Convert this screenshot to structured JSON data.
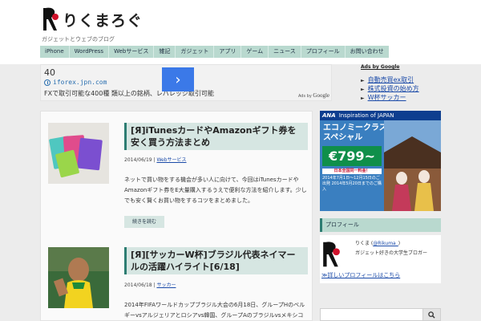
{
  "site": {
    "logo_text": "りくまろぐ",
    "tagline": "ガジェットとウェブのブログ"
  },
  "nav": {
    "items": [
      "iPhone",
      "WordPress",
      "Webサービス",
      "雑記",
      "ガジェット",
      "アプリ",
      "ゲーム",
      "ニュース",
      "プロフィール",
      "お問い合わせ"
    ]
  },
  "ad_top": {
    "price": "40",
    "url": "iforex.jpn.com",
    "description": "FXで取引可能な400種 類以上の銘柄、レバレッジ取引可能",
    "arrow": "›",
    "ads_by": "Ads by",
    "google": "Google"
  },
  "side_ads": {
    "heading": "Ads by Google",
    "links": [
      "自動売買ex取引",
      "株式投資の始め方",
      "W杯サッカー"
    ]
  },
  "posts": [
    {
      "title": "[Я]iTunesカードやAmazonギフト券を安く買う方法まとめ",
      "date": "2014/06/19",
      "category": "Webサービス",
      "excerpt": "ネットで買い物をする機会が多い人に向けて、今回はiTunesカードやAmazonギフト券をE大量購入するうえで便利な方法を紹介します。少しでも安く賢くお買い物をするコツをまとめました。",
      "more": "続きを読む"
    },
    {
      "title": "[Я][サッカーW杯]ブラジル代表ネイマールの活躍ハイライト[6/18]",
      "date": "2014/06/18",
      "category": "サッカー",
      "excerpt": "2014年FIFAワールドカップブラジル大会の6月18日、グループHのベルギーvsアルジェリアとロシアvs韓国、グループAのブラジルvsメキシコの結果をまとめました。"
    }
  ],
  "banner": {
    "airline": "ANA",
    "tagline": "Inspiration of JAPAN",
    "copy_line1": "エコノミークラス",
    "copy_line2": "スペシャル",
    "price": "€799~",
    "notice": "日本全国同一料金！",
    "small_text": "2014年7月1日～12月15日のご出発 2014年5月20日までのご購入"
  },
  "profile": {
    "widget_title": "プロフィール",
    "name": "りくま",
    "handle": "@Rikuma_",
    "description": "ガジェット好きの大学生ブロガー",
    "link": "≫詳しいプロフィールはこちら"
  },
  "search": {
    "placeholder": ""
  },
  "colors": {
    "accent": "#2d7d72",
    "nav_bg": "#b9d9cf",
    "link": "#1a4aa8"
  }
}
